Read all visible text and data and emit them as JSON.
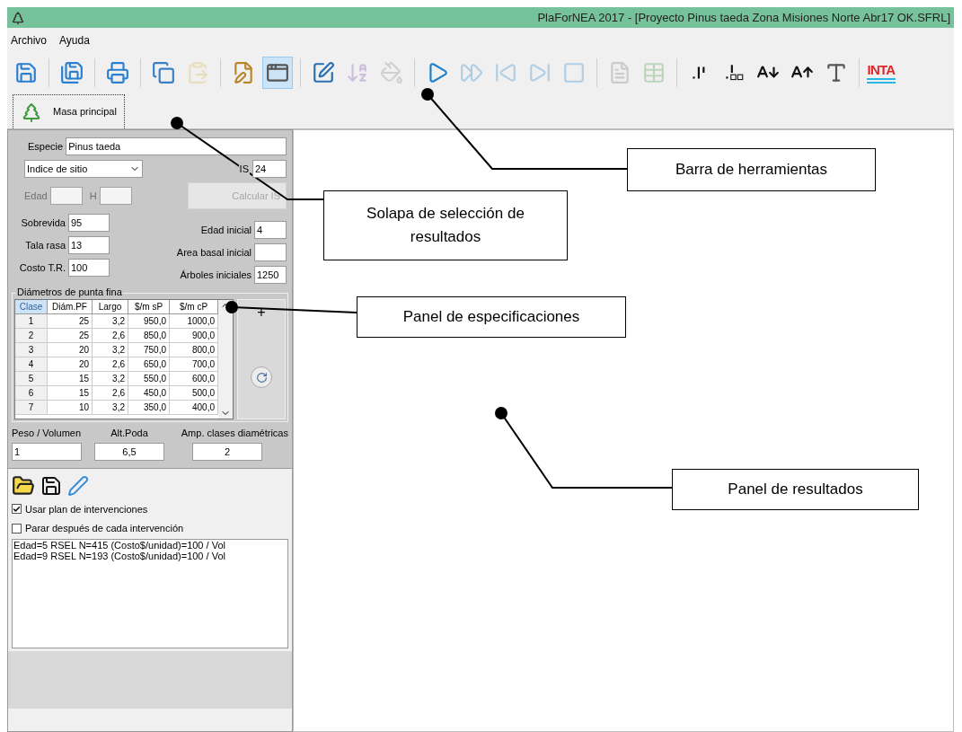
{
  "window": {
    "title": "PlaForNEA 2017 - [Proyecto Pinus taeda Zona Misiones Norte Abr17 OK.SFRL]"
  },
  "menu": [
    "Archivo",
    "Ayuda"
  ],
  "toolbar": {
    "groups": [
      [
        {
          "disabled": false,
          "pressed": false
        }
      ],
      [
        {
          "disabled": false,
          "pressed": false
        }
      ],
      [
        {
          "disabled": false,
          "pressed": false
        }
      ],
      [
        {
          "disabled": false,
          "pressed": false
        },
        {
          "disabled": true,
          "pressed": false
        }
      ],
      [
        {
          "disabled": false,
          "pressed": false
        },
        {
          "disabled": false,
          "pressed": true
        }
      ],
      [
        {
          "disabled": false,
          "pressed": false
        },
        {
          "disabled": true,
          "pressed": false
        },
        {
          "disabled": true,
          "pressed": false
        }
      ],
      [
        {
          "disabled": false,
          "pressed": false
        },
        {
          "disabled": true,
          "pressed": false
        },
        {
          "disabled": true,
          "pressed": false
        },
        {
          "disabled": true,
          "pressed": false
        },
        {
          "disabled": true,
          "pressed": false
        }
      ],
      [
        {
          "disabled": true,
          "pressed": false
        },
        {
          "disabled": true,
          "pressed": false
        }
      ],
      [
        {
          "disabled": false,
          "pressed": false
        },
        {
          "disabled": false,
          "pressed": false
        },
        {
          "disabled": false,
          "pressed": false
        },
        {
          "disabled": false,
          "pressed": false
        },
        {
          "disabled": false,
          "pressed": false
        }
      ]
    ],
    "logo": "INTA"
  },
  "tabs": [
    {
      "label": "Masa principal",
      "selected": true
    }
  ],
  "specs": {
    "species": {
      "label": "Especie",
      "value": "Pinus taeda"
    },
    "method": {
      "value": "Indice de sitio"
    },
    "is": {
      "label": "IS",
      "value": "24"
    },
    "age": {
      "label": "Edad",
      "disabled": true
    },
    "height": {
      "label": "H",
      "disabled": true
    },
    "calc_button": {
      "label": "Calcular IS",
      "disabled": true
    },
    "left_fields": [
      {
        "label": "Sobrevida",
        "value": "95"
      },
      {
        "label": "Tala rasa",
        "value": "13"
      },
      {
        "label": "Costo T.R.",
        "value": "100"
      }
    ],
    "right_fields": [
      {
        "label": "Edad inicial",
        "value": "4"
      },
      {
        "label": "Area basal inicial"
      },
      {
        "label": "Árboles iniciales",
        "value": "1250"
      }
    ]
  },
  "diameters": {
    "title": "Diámetros de punta fina",
    "columns": [
      "Clase",
      "Diám.PF",
      "Largo",
      "$/m sP",
      "$/m cP"
    ],
    "rows": [
      [
        "1",
        "25",
        "3,2",
        "950,0",
        "1000,0"
      ],
      [
        "2",
        "25",
        "2,6",
        "850,0",
        "900,0"
      ],
      [
        "3",
        "20",
        "3,2",
        "750,0",
        "800,0"
      ],
      [
        "4",
        "20",
        "2,6",
        "650,0",
        "700,0"
      ],
      [
        "5",
        "15",
        "3,2",
        "550,0",
        "600,0"
      ],
      [
        "6",
        "15",
        "2,6",
        "450,0",
        "500,0"
      ],
      [
        "7",
        "10",
        "3,2",
        "350,0",
        "400,0"
      ]
    ],
    "add_button": "+"
  },
  "params": [
    {
      "label": "Peso / Volumen",
      "value": "1"
    },
    {
      "label": "Alt.Poda",
      "value": "6,5"
    },
    {
      "label": "Amp. clases diamétricas",
      "value": "2"
    }
  ],
  "options": [
    {
      "label": "Usar plan de intervenciones",
      "checked": true
    },
    {
      "label": "Parar después de cada intervención",
      "checked": false
    }
  ],
  "interventions": [
    "Edad=5 RSEL N=415 (Costo$/unidad)=100 / Vol",
    "Edad=9 RSEL N=193 (Costo$/unidad)=100 / Vol"
  ],
  "callouts": [
    {
      "text": "Barra de herramientas"
    },
    {
      "text": "Solapa de selección de resultados"
    },
    {
      "text": "Panel de especificaciones"
    },
    {
      "text": "Panel de resultados"
    }
  ]
}
